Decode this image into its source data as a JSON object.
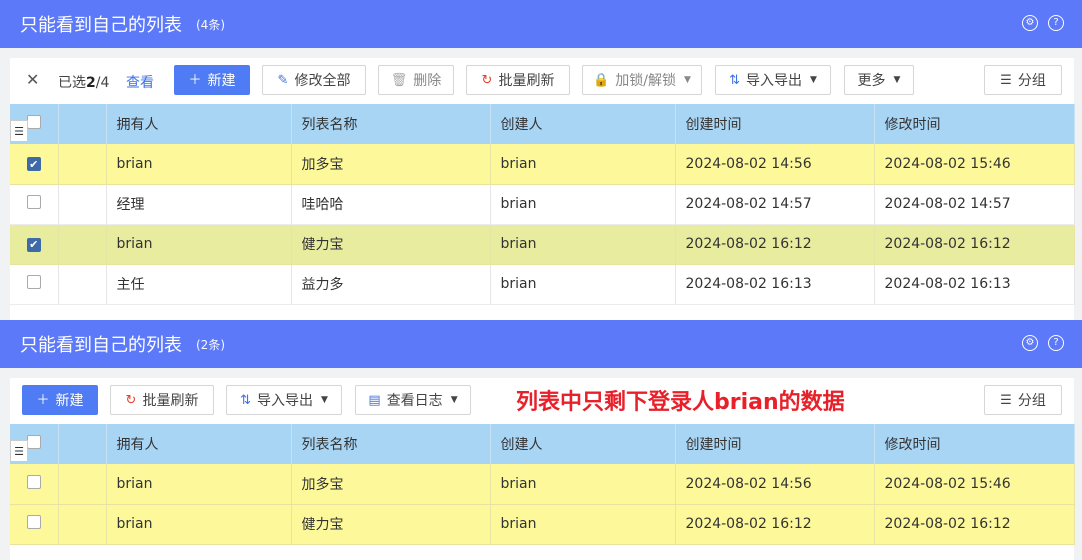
{
  "top": {
    "title": "只能看到自己的列表",
    "count": "(4条)",
    "toolbar": {
      "selected_prefix": "已选",
      "selected_count": "2",
      "selected_total": "/4",
      "view": "查看",
      "new": "新建",
      "edit_all": "修改全部",
      "delete": "删除",
      "batch_refresh": "批量刷新",
      "lock_unlock": "加锁/解锁",
      "import_export": "导入导出",
      "more": "更多",
      "group": "分组"
    },
    "columns": [
      "拥有人",
      "列表名称",
      "创建人",
      "创建时间",
      "修改时间"
    ],
    "rows": [
      {
        "owner": "brian",
        "name": "加多宝",
        "creator": "brian",
        "created": "2024-08-02 14:56",
        "modified": "2024-08-02 15:46",
        "checked": true
      },
      {
        "owner": "经理",
        "name": "哇哈哈",
        "creator": "brian",
        "created": "2024-08-02 14:57",
        "modified": "2024-08-02 14:57",
        "checked": false
      },
      {
        "owner": "brian",
        "name": "健力宝",
        "creator": "brian",
        "created": "2024-08-02 16:12",
        "modified": "2024-08-02 16:12",
        "checked": true
      },
      {
        "owner": "主任",
        "name": "益力多",
        "creator": "brian",
        "created": "2024-08-02 16:13",
        "modified": "2024-08-02 16:13",
        "checked": false
      }
    ]
  },
  "bottom": {
    "title": "只能看到自己的列表",
    "count": "(2条)",
    "toolbar": {
      "new": "新建",
      "batch_refresh": "批量刷新",
      "import_export": "导入导出",
      "view_log": "查看日志",
      "group": "分组"
    },
    "annotation": "列表中只剩下登录人brian的数据",
    "columns": [
      "拥有人",
      "列表名称",
      "创建人",
      "创建时间",
      "修改时间"
    ],
    "rows": [
      {
        "owner": "brian",
        "name": "加多宝",
        "creator": "brian",
        "created": "2024-08-02 14:56",
        "modified": "2024-08-02 15:46"
      },
      {
        "owner": "brian",
        "name": "健力宝",
        "creator": "brian",
        "created": "2024-08-02 16:12",
        "modified": "2024-08-02 16:12"
      }
    ]
  },
  "colors": {
    "header": "#5b79f8",
    "primary": "#4f7cf4",
    "table_header": "#a9d5f5",
    "highlight": "#fdf99a",
    "annotation": "#e8202a"
  }
}
